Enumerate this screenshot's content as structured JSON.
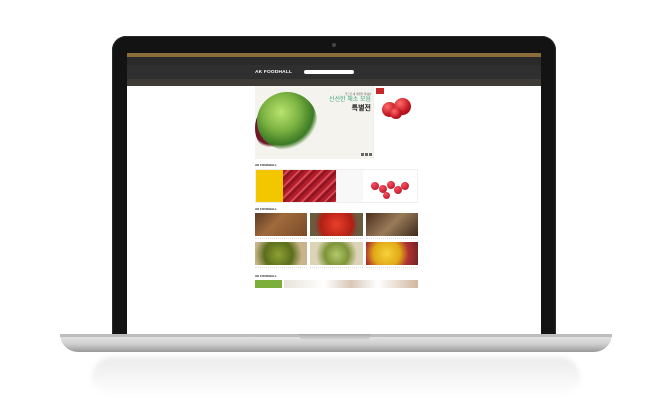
{
  "site": {
    "logo": "AK FOODHALL",
    "search_placeholder": "",
    "util_left": [
      "",
      ""
    ],
    "util_right": [
      "",
      ""
    ],
    "head_right": [
      "",
      ""
    ],
    "nav": [
      "",
      "",
      "",
      "",
      ""
    ],
    "active_nav_index": 4
  },
  "hero": {
    "kicker": "푸르른 새 계절을 위하여",
    "title": "신선한 채소 모음",
    "big": "특별전",
    "sub": [
      "",
      ""
    ],
    "side_badge": "",
    "side_name": "",
    "side_price": "",
    "side_old": ""
  },
  "section1": {
    "title": "AK FOODHALL",
    "sub": "",
    "b1": "",
    "b3": ""
  },
  "section2": {
    "title": "AK FOODHALL",
    "sub": "",
    "items": [
      {
        "name": "",
        "desc": "",
        "price": ""
      },
      {
        "name": "",
        "desc": "",
        "price": ""
      },
      {
        "name": "",
        "desc": "",
        "price": ""
      },
      {
        "name": "",
        "desc": "",
        "price": ""
      },
      {
        "name": "",
        "desc": "",
        "price": ""
      },
      {
        "name": "",
        "desc": "",
        "price": ""
      }
    ]
  },
  "section3": {
    "title": "AK FOODHALL",
    "sub": "",
    "green": ""
  },
  "colors": {
    "accent": "#c9a06a",
    "topbar": "#8a6d3b",
    "header": "#2f2f2f",
    "hero_title": "#3a9f7a",
    "link": "#c46a14"
  }
}
